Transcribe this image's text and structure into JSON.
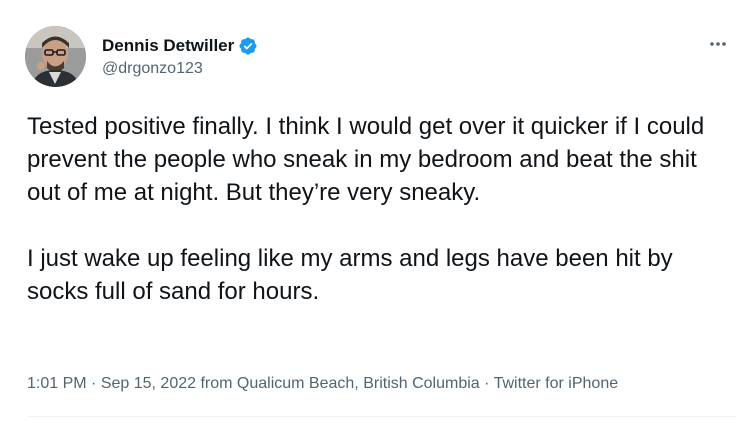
{
  "author": {
    "display_name": "Dennis Detwiller",
    "handle": "@drgonzo123",
    "verified": true
  },
  "tweet": {
    "text": "Tested positive finally. I think I would get over it quicker if I could prevent the people who sneak in my bedroom and beat the shit out of me at night. But they’re very sneaky.\n\nI just wake up feeling like my arms and legs have been hit by socks full of sand for hours."
  },
  "meta": {
    "time": "1:01 PM",
    "separator": " · ",
    "date": "Sep 15, 2022",
    "location": " from Qualicum Beach, British Columbia",
    "source": "Twitter for iPhone"
  },
  "icons": {
    "verified": "verified-badge-icon",
    "more": "more-options-icon"
  },
  "colors": {
    "verified_blue": "#1d9bf0",
    "secondary_text": "#536471",
    "primary_text": "#0f1419"
  }
}
